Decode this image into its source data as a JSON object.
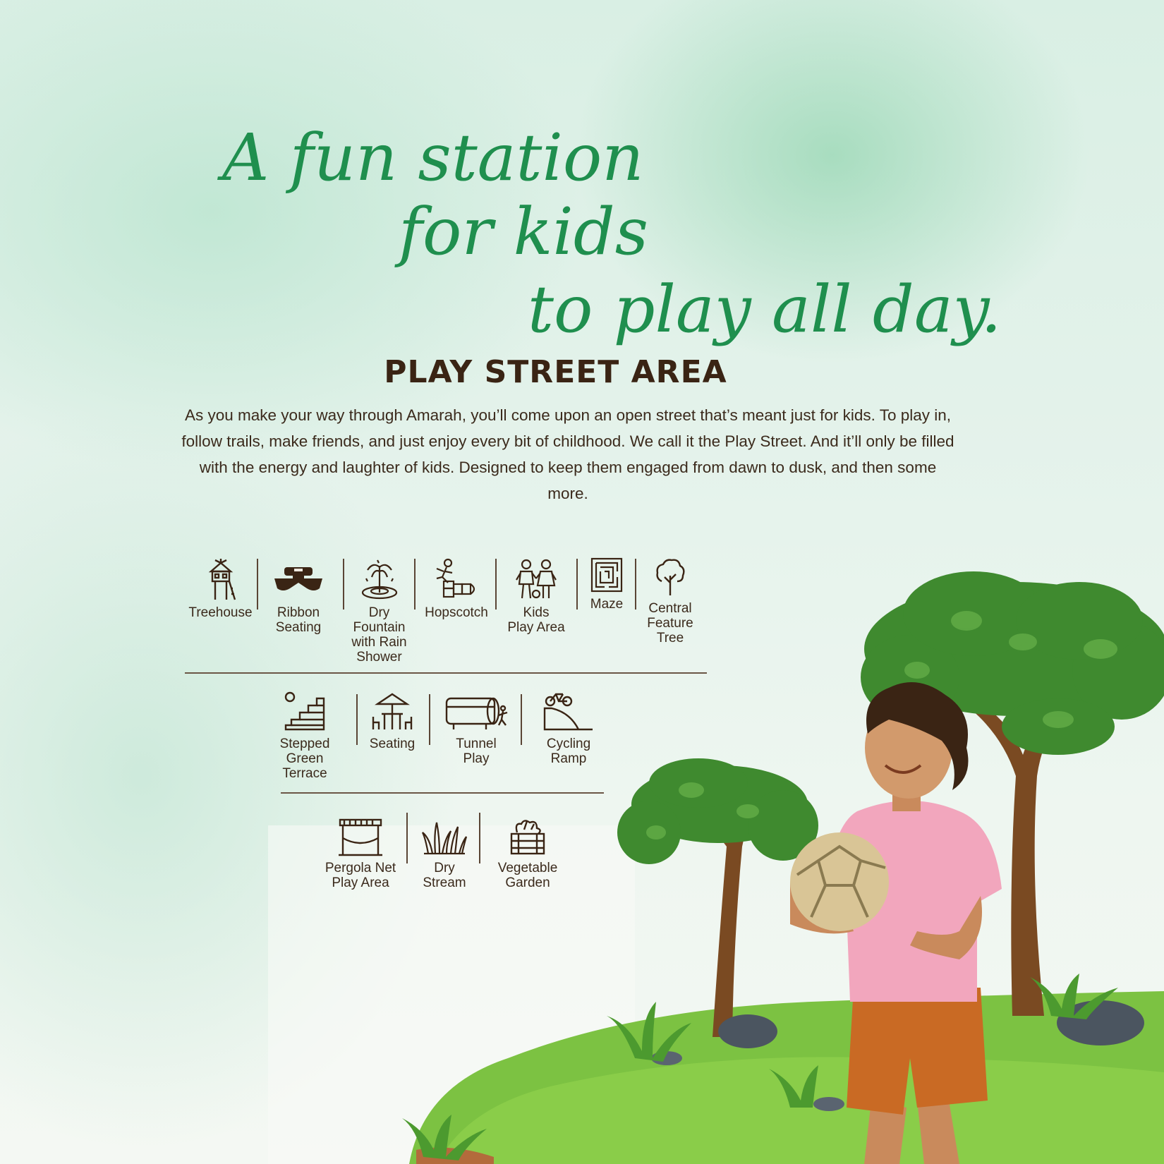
{
  "headline": {
    "line1": "A fun station",
    "line2": "for kids",
    "line3": "to play all day."
  },
  "section_title": "PLAY STREET AREA",
  "description": "As you make your way through Amarah, you’ll come upon an open street that’s meant just for kids. To play in, follow trails, make friends, and just enjoy every bit of childhood. We call it the Play Street. And it’ll only be filled with the energy and laughter of kids. Designed to keep them engaged from dawn to dusk, and then some more.",
  "amenities": {
    "row1": [
      {
        "icon": "treehouse-icon",
        "label": "Treehouse"
      },
      {
        "icon": "picnic-table-icon",
        "label": "Ribbon\nSeating"
      },
      {
        "icon": "fountain-icon",
        "label": "Dry\nFountain\nwith Rain\nShower"
      },
      {
        "icon": "hopscotch-icon",
        "label": "Hopscotch"
      },
      {
        "icon": "kids-icon",
        "label": "Kids\nPlay Area"
      },
      {
        "icon": "maze-icon",
        "label": "Maze"
      },
      {
        "icon": "tree-icon",
        "label": "Central\nFeature\nTree"
      }
    ],
    "row2": [
      {
        "icon": "stairs-icon",
        "label": "Stepped\nGreen\nTerrace"
      },
      {
        "icon": "umbrella-table-icon",
        "label": "Seating"
      },
      {
        "icon": "tunnel-icon",
        "label": "Tunnel\nPlay"
      },
      {
        "icon": "cycling-ramp-icon",
        "label": "Cycling\nRamp"
      }
    ],
    "row3": [
      {
        "icon": "pergola-icon",
        "label": "Pergola Net\nPlay Area"
      },
      {
        "icon": "grass-icon",
        "label": "Dry\nStream"
      },
      {
        "icon": "vegetable-crate-icon",
        "label": "Vegetable\nGarden"
      }
    ]
  },
  "colors": {
    "headline": "#1f8f4e",
    "text": "#3b2a1c",
    "icon": "#3a2414",
    "grass": "#7cc242",
    "tree": "#3f8a2f"
  }
}
